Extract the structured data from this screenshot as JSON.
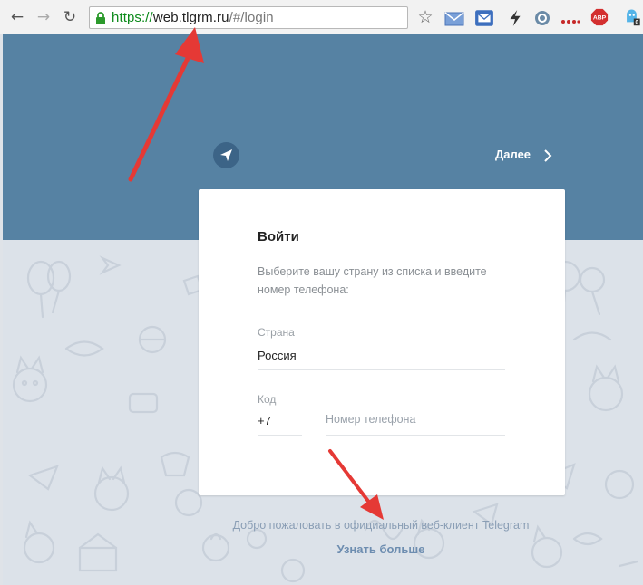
{
  "browser": {
    "url_scheme": "https://",
    "url_host": "web.tlgrm.ru",
    "url_path": "/#/login",
    "icons": [
      "back-icon",
      "forward-icon",
      "reload-icon",
      "lock-icon",
      "star-icon",
      "gmail-icon",
      "inbox-icon",
      "lightning-icon",
      "sync-icon",
      "more-dots-icon",
      "adblock-icon",
      "ghost-icon"
    ],
    "adblock_label": "ABP",
    "badge_count": "0"
  },
  "header": {
    "next_label": "Далее"
  },
  "login": {
    "title": "Войти",
    "description": "Выберите вашу страну из списка и введите номер телефона:",
    "country_label": "Страна",
    "country_value": "Россия",
    "code_label": "Код",
    "code_value": "+7",
    "phone_placeholder": "Номер телефона"
  },
  "footer": {
    "welcome_text": "Добро пожаловать в официальный веб-клиент Telegram",
    "learn_more": "Узнать больше"
  },
  "colors": {
    "header": "#5682a3",
    "background": "#dce2e9",
    "annotation_arrow": "#e53935"
  }
}
